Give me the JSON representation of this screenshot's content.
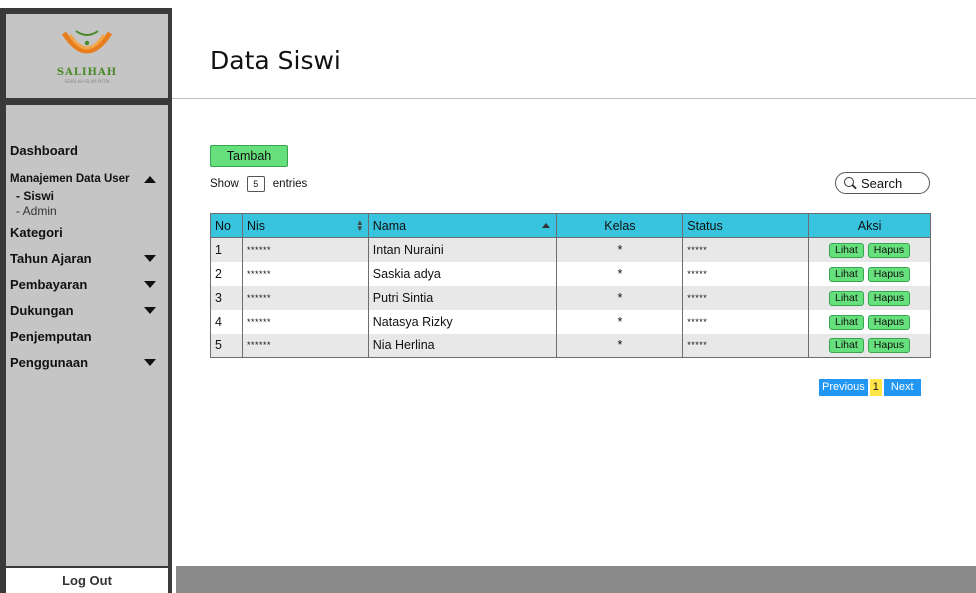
{
  "sidebar": {
    "logo": {
      "brand": "SALIHAH",
      "tagline": "SEKOLAH ISLAM PUTRI"
    },
    "items": [
      {
        "label": "Dashboard",
        "caret": "none"
      },
      {
        "label": "Manajemen Data User",
        "caret": "up",
        "children": [
          {
            "label": "- Siswi",
            "active": true
          },
          {
            "label": "- Admin",
            "active": false
          }
        ]
      },
      {
        "label": "Kategori",
        "caret": "none"
      },
      {
        "label": "Tahun Ajaran",
        "caret": "down"
      },
      {
        "label": "Pembayaran",
        "caret": "down"
      },
      {
        "label": "Dukungan",
        "caret": "down"
      },
      {
        "label": "Penjemputan",
        "caret": "none"
      },
      {
        "label": "Penggunaan",
        "caret": "down"
      }
    ],
    "logout_label": "Log Out"
  },
  "header": {
    "title": "Data Siswi"
  },
  "main": {
    "add_button_label": "Tambah",
    "show_label": "Show",
    "entries_value": "5",
    "entries_label": "entries",
    "search_label": "Search",
    "table": {
      "columns": [
        "No",
        "Nis",
        "Nama",
        "Kelas",
        "Status",
        "Aksi"
      ],
      "rows": [
        {
          "no": "1",
          "nis": "******",
          "nama": "Intan Nuraini",
          "kelas": "*",
          "status": "*****"
        },
        {
          "no": "2",
          "nis": "******",
          "nama": "Saskia adya",
          "kelas": "*",
          "status": "*****"
        },
        {
          "no": "3",
          "nis": "******",
          "nama": "Putri Sintia",
          "kelas": "*",
          "status": "*****"
        },
        {
          "no": "4",
          "nis": "******",
          "nama": "Natasya Rizky",
          "kelas": "*",
          "status": "*****"
        },
        {
          "no": "5",
          "nis": "******",
          "nama": "Nia Herlina",
          "kelas": "*",
          "status": "*****"
        }
      ],
      "action_view_label": "Lihat",
      "action_delete_label": "Hapus"
    },
    "pagination": {
      "previous_label": "Previous",
      "current_page": "1",
      "next_label": "Next"
    }
  },
  "colors": {
    "table_header": "#38c3de",
    "button_green": "#66e07d",
    "pager_blue": "#2196f3",
    "pager_current": "#ffe44a",
    "sidebar_gray": "#c5c5c5"
  }
}
